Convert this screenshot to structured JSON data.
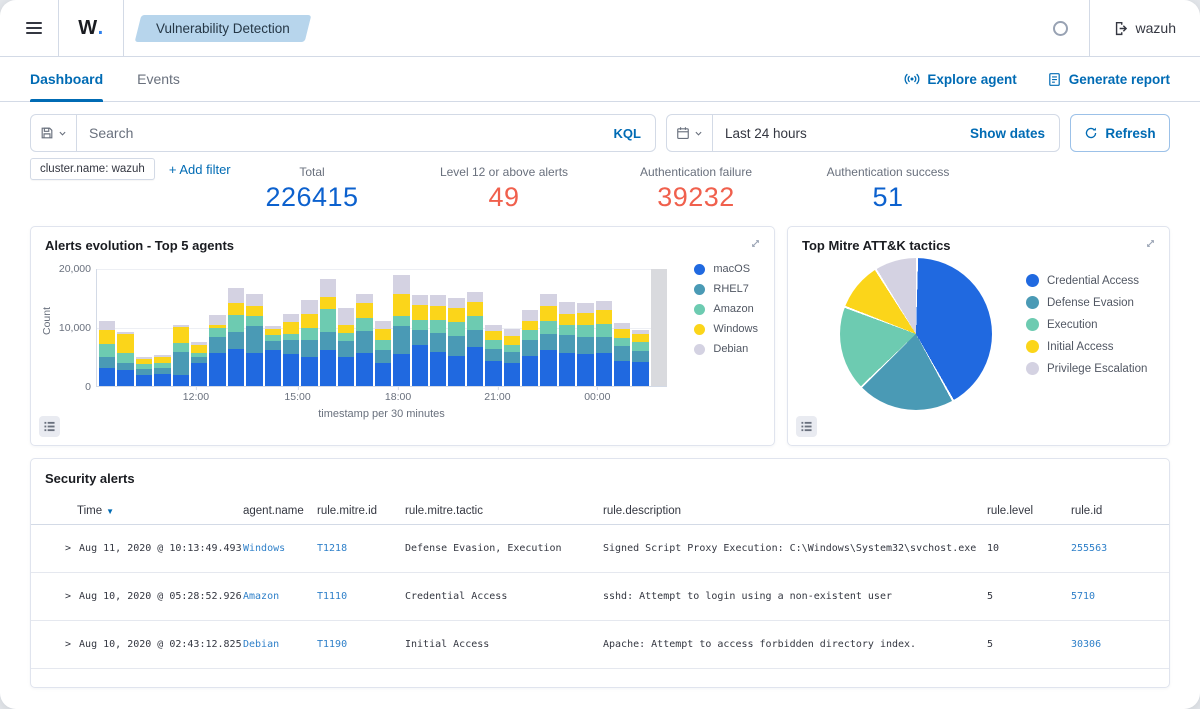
{
  "header": {
    "logo": "W",
    "logo_dot": ".",
    "breadcrumb": "Vulnerability Detection",
    "user": "wazuh"
  },
  "tabs": [
    {
      "label": "Dashboard",
      "active": true
    },
    {
      "label": "Events",
      "active": false
    }
  ],
  "actions": [
    {
      "label": "Explore agent"
    },
    {
      "label": "Generate report"
    }
  ],
  "search": {
    "placeholder": "Search",
    "language": "KQL"
  },
  "datepicker": {
    "range": "Last 24 hours",
    "show_dates_label": "Show dates",
    "refresh_label": "Refresh"
  },
  "filters": {
    "chips": [
      "cluster.name: wazuh"
    ],
    "add_label": "+ Add filter"
  },
  "stats": [
    {
      "key": "total",
      "label": "Total",
      "value": "226415",
      "color": "#0c61ce"
    },
    {
      "key": "level-12-or-above",
      "label": "Level 12 or above alerts",
      "value": "49",
      "color": "#f0604d"
    },
    {
      "key": "auth-failure",
      "label": "Authentication failure",
      "value": "39232",
      "color": "#f0604d"
    },
    {
      "key": "auth-success",
      "label": "Authentication success",
      "value": "51",
      "color": "#0c61ce"
    }
  ],
  "chart_data": [
    {
      "type": "bar",
      "stacked": true,
      "title": "Alerts evolution - Top 5 agents",
      "xlabel": "timestamp per 30 minutes",
      "ylabel": "Count",
      "ylim": [
        0,
        20000
      ],
      "yticks": [
        {
          "label": "0",
          "value": 0
        },
        {
          "label": "10,000",
          "value": 10000
        },
        {
          "label": "20,000",
          "value": 20000
        }
      ],
      "xticks": [
        {
          "label": "12:00",
          "pos": 17.5
        },
        {
          "label": "15:00",
          "pos": 35.3
        },
        {
          "label": "18:00",
          "pos": 52.9
        },
        {
          "label": "21:00",
          "pos": 70.3
        },
        {
          "label": "00:00",
          "pos": 87.8
        }
      ],
      "legend_position": "right",
      "series": [
        {
          "name": "macOS",
          "color": "#2069e0",
          "values": [
            3100,
            2700,
            1900,
            2100,
            1900,
            4000,
            5600,
            6400,
            5600,
            6100,
            5500,
            5000,
            6100,
            4900,
            5600,
            3900,
            5500,
            7000,
            5800,
            5200,
            6600,
            4200,
            4000,
            5200,
            6100,
            5600,
            5400,
            5700,
            4300,
            4100
          ]
        },
        {
          "name": "RHEL7",
          "color": "#4a9ab5",
          "values": [
            1900,
            1200,
            1000,
            900,
            3900,
            900,
            2700,
            2900,
            4700,
            1600,
            2300,
            2900,
            3200,
            2800,
            3800,
            2200,
            4800,
            2500,
            3300,
            3300,
            3000,
            2100,
            1800,
            2600,
            2800,
            3100,
            3000,
            2600,
            2500,
            1900
          ]
        },
        {
          "name": "Amazon",
          "color": "#6dcbb1",
          "values": [
            2200,
            1800,
            800,
            900,
            1500,
            800,
            1600,
            2900,
            1700,
            1100,
            1100,
            2000,
            3900,
            1300,
            2200,
            1700,
            1700,
            1800,
            2200,
            2400,
            2400,
            1500,
            1300,
            1800,
            2200,
            1800,
            2000,
            2300,
            1400,
            1500
          ]
        },
        {
          "name": "Windows",
          "color": "#fbd51a",
          "values": [
            2300,
            3200,
            900,
            1000,
            2800,
            1300,
            600,
            2000,
            1700,
            900,
            2000,
            2400,
            2100,
            1500,
            2600,
            1900,
            3700,
            2500,
            2400,
            2500,
            2300,
            1600,
            1400,
            1600,
            2600,
            1900,
            2100,
            2400,
            1500,
            1400
          ]
        },
        {
          "name": "Debian",
          "color": "#d4d2e2",
          "values": [
            1600,
            400,
            300,
            400,
            300,
            600,
            1700,
            2600,
            2000,
            600,
            1500,
            2400,
            3000,
            2800,
            1500,
            1500,
            3200,
            1700,
            1900,
            1600,
            1800,
            1000,
            1300,
            1800,
            2000,
            1900,
            1700,
            1600,
            1000,
            700
          ]
        }
      ],
      "incomplete_bucket": {
        "value": 20000,
        "color": "#d9dade"
      }
    },
    {
      "type": "pie",
      "title": "Top Mitre ATT&K tactics",
      "legend_position": "right",
      "slices": [
        {
          "label": "Credential Access",
          "pct": 41.7,
          "color": "#2069e0"
        },
        {
          "label": "Defense Evasion",
          "pct": 20.8,
          "color": "#4a9ab5"
        },
        {
          "label": "Execution",
          "pct": 18.1,
          "color": "#6dcbb1"
        },
        {
          "label": "Initial Access",
          "pct": 10.3,
          "color": "#fbd51a"
        },
        {
          "label": "Privilege Escalation",
          "pct": 9.1,
          "color": "#d4d2e2"
        }
      ]
    }
  ],
  "table": {
    "title": "Security alerts",
    "columns": [
      "Time",
      "agent.name",
      "rule.mitre.id",
      "rule.mitre.tactic",
      "rule.description",
      "rule.level",
      "rule.id"
    ],
    "rows": [
      {
        "time": "Aug 11, 2020 @ 10:13:49.493",
        "agent": "Windows",
        "mitre_id": "T1218",
        "tactic": "Defense Evasion, Execution",
        "description": "Signed Script Proxy Execution: C:\\Windows\\System32\\svchost.exe",
        "level": "10",
        "rule_id": "255563"
      },
      {
        "time": "Aug 10, 2020 @ 05:28:52.926",
        "agent": "Amazon",
        "mitre_id": "T1110",
        "tactic": "Credential Access",
        "description": "sshd: Attempt to login using a non-existent user",
        "level": "5",
        "rule_id": "5710"
      },
      {
        "time": "Aug 10, 2020 @ 02:43:12.825",
        "agent": "Debian",
        "mitre_id": "T1190",
        "tactic": "Initial Access",
        "description": "Apache: Attempt to access forbidden directory index.",
        "level": "5",
        "rule_id": "30306"
      }
    ]
  }
}
